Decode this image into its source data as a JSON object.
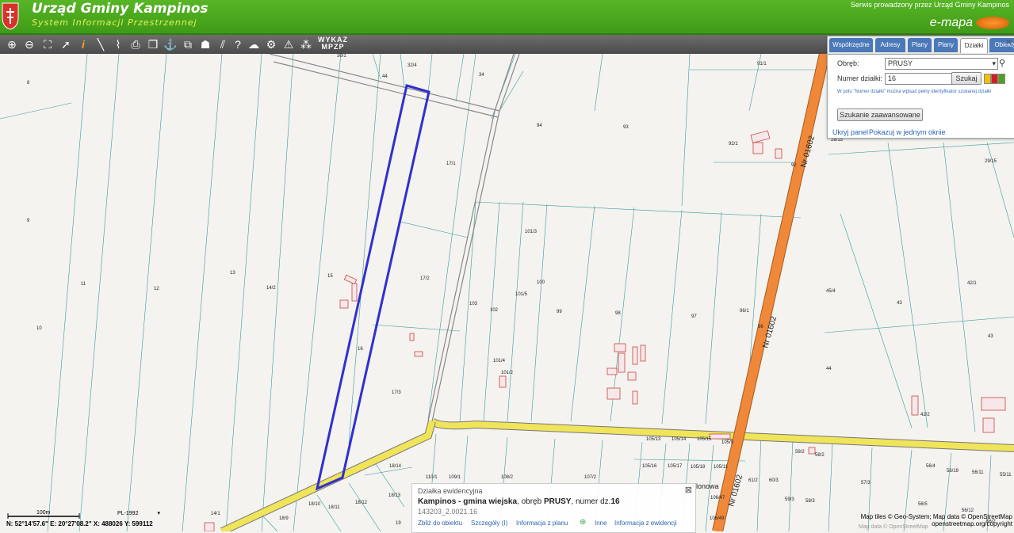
{
  "header": {
    "title": "Urząd Gminy Kampinos",
    "subtitle": "System Informacji Przestrzennej",
    "service": "Serwis prowadzony przez Urząd Gminy Kampinos",
    "brand": "e-mapa"
  },
  "toolbar": {
    "tools": [
      "zoom-in-icon",
      "zoom-out-icon",
      "zoom-extent-icon",
      "pointer-icon",
      "info-icon",
      "measure-length-icon",
      "measure-area-icon",
      "print-icon",
      "layers-icon",
      "anchor-icon",
      "compare-icon",
      "view-icon",
      "stripes-icon",
      "help-icon",
      "cloud-icon",
      "settings-icon",
      "warning-icon",
      "points-icon"
    ],
    "wykaz": "WYKAZ",
    "mpzp": "MPZP"
  },
  "panel": {
    "tabs": [
      "Współrzędne",
      "Adresy",
      "Plany",
      "Plany",
      "Działki",
      "Obiekty"
    ],
    "active_tab": "Działki",
    "obreb_label": "Obręb:",
    "obreb_value": "PRUSY",
    "numer_label": "Numer działki:",
    "numer_value": "16",
    "search_label": "Szukaj",
    "hint": "W polu \"Numer działki\" można wpisać pełny identyfikator szukanej działki",
    "advanced_label": "Szukanie zaawansowane",
    "hide_panel": "Ukryj panel",
    "show_window": "Pokazuj w jednym oknie"
  },
  "popup": {
    "heading": "Działka ewidencyjna",
    "line_bold": "Kampinos - gmina wiejska",
    "line_mid": ", obręb ",
    "line_obreb": "PRUSY",
    "line_rest": ", numer dz.",
    "line_num": "16",
    "id": "143203_2.0021.16",
    "links": [
      "Zbliż do obiektu",
      "Szczegóły (I)",
      "Informacja z planu",
      "Inne",
      "Informacja z ewidencji"
    ]
  },
  "status": {
    "scale": "100m",
    "crs": "PL-1992",
    "coords": "N: 52°14'57.6\"  E: 20°27'08.2\"  X: 488026    Y: 599112"
  },
  "attribution": {
    "line1": "Map tiles © Geo-System; Map data © OpenStreetMap",
    "line2": "openstreetmap.org/copyright",
    "line3": "Map data © OpenStreetMap"
  },
  "map": {
    "road_labels": [
      "Nr 01602",
      "Nr 01602",
      "Klonowa"
    ],
    "parcels": [
      "30/1",
      "32/4",
      "34",
      "44",
      "8",
      "94",
      "93",
      "91/1",
      "17/1",
      "92/1",
      "92",
      "28/15",
      "29/15",
      "9",
      "101/3",
      "11",
      "12",
      "13",
      "14/2",
      "15",
      "17/2",
      "103",
      "102",
      "101/5",
      "100",
      "99",
      "98",
      "97",
      "96/1",
      "96",
      "45/4",
      "42/1",
      "43",
      "43",
      "10",
      "16",
      "44",
      "17/3",
      "101/4",
      "101/2",
      "105/13",
      "105/14",
      "105/15",
      "105/9",
      "42/2",
      "105/16",
      "105/17",
      "105/18",
      "105/11",
      "59/2",
      "58/2",
      "18/14",
      "110/1",
      "109/1",
      "108/2",
      "107/2",
      "56/4",
      "56/19",
      "56/11",
      "55/11",
      "14/1",
      "18/11",
      "18/12",
      "18/13",
      "18/10",
      "18/9",
      "19",
      "61/2",
      "60/3",
      "57/3",
      "106/47",
      "106/49",
      "59/3",
      "58/3",
      "56/5",
      "56/12",
      "56/2"
    ],
    "colors": {
      "selection": "#3030d0",
      "road_yellow": "#f0e45a",
      "road_orange": "#f0883a",
      "header_green": "#4aa81c",
      "building": "#c44"
    }
  }
}
